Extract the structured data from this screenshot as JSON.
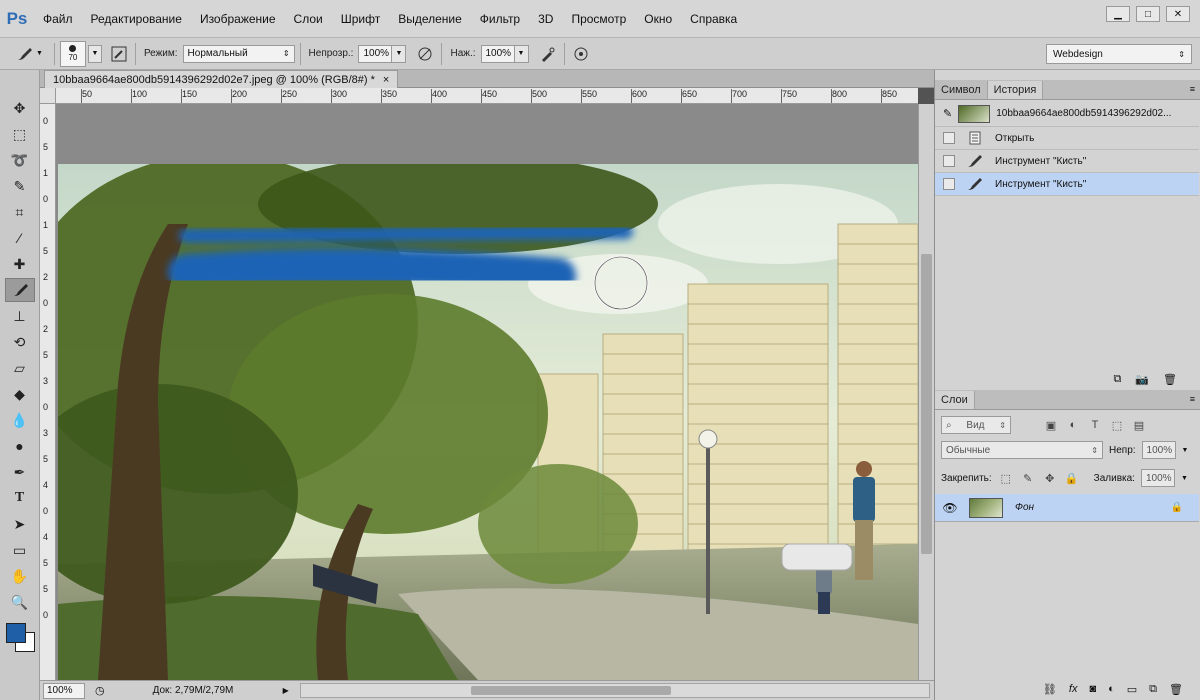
{
  "app": {
    "logo": "Ps"
  },
  "menu": [
    "Файл",
    "Редактирование",
    "Изображение",
    "Слои",
    "Шрифт",
    "Выделение",
    "Фильтр",
    "3D",
    "Просмотр",
    "Окно",
    "Справка"
  ],
  "options": {
    "brush_size": "70",
    "mode_label": "Режим:",
    "mode_value": "Нормальный",
    "opacity_label": "Непрозр.:",
    "opacity_value": "100%",
    "flow_label": "Наж.:",
    "flow_value": "100%",
    "workspace": "Webdesign"
  },
  "document": {
    "tab_title": "10bbaa9664ae800db5914396292d02e7.jpeg @ 100% (RGB/8#) *",
    "close_glyph": "×"
  },
  "ruler": {
    "top_ticks": [
      "50",
      "100",
      "150",
      "200",
      "250",
      "300",
      "350",
      "400",
      "450",
      "500",
      "550",
      "600",
      "650",
      "700",
      "750",
      "800",
      "850"
    ],
    "left_ticks": [
      "0",
      "5",
      "1",
      "0",
      "1",
      "5",
      "2",
      "0",
      "2",
      "5",
      "3",
      "0",
      "3",
      "5",
      "4",
      "0",
      "4",
      "5",
      "5",
      "0"
    ]
  },
  "history_panel": {
    "tabs": [
      "Символ",
      "История"
    ],
    "snapshot": "10bbaa9664ae800db5914396292d02...",
    "items": [
      {
        "label": "Открыть",
        "icon": "document-icon"
      },
      {
        "label": "Инструмент \"Кисть\"",
        "icon": "brush-icon"
      },
      {
        "label": "Инструмент \"Кисть\"",
        "icon": "brush-icon"
      }
    ]
  },
  "layers_panel": {
    "tab": "Слои",
    "filter_label": "Вид",
    "blend_mode": "Обычные",
    "opacity_label": "Непр:",
    "opacity_value": "100%",
    "lock_label": "Закрепить:",
    "fill_label": "Заливка:",
    "fill_value": "100%",
    "layer_name": "Фон"
  },
  "status": {
    "zoom": "100%",
    "doc_size": "Док: 2,79M/2,79M"
  },
  "colors": {
    "foreground": "#1e5fa8",
    "background": "#ffffff",
    "selection": "#bcd3f3",
    "brush_stroke": "#1b63b5"
  }
}
